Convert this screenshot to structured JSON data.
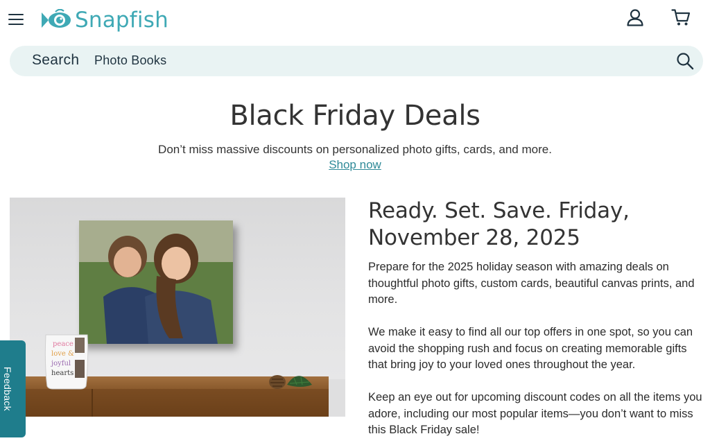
{
  "header": {
    "logo_text": "Snapfish",
    "menu_icon": "hamburger-menu-icon",
    "account_icon": "user-icon",
    "cart_icon": "cart-icon",
    "brand_color": "#3fa9b5"
  },
  "search": {
    "label": "Search",
    "value": "Photo Books",
    "icon": "search-icon",
    "background": "#e9f3f3"
  },
  "hero": {
    "title": "Black Friday Deals",
    "subtitle": "Don’t miss massive discounts on personalized photo gifts, cards, and more.",
    "link_label": "Shop now"
  },
  "image": {
    "mug_text": [
      "peace",
      "love &",
      "joyful",
      "hearts"
    ]
  },
  "article": {
    "heading": "Ready. Set. Save. Friday, November 28, 2025",
    "paragraphs": [
      "Prepare for the 2025 holiday season with amazing deals on thoughtful photo gifts, custom cards, beautiful canvas prints, and more.",
      "We make it easy to find all our top offers in one spot, so you can avoid the shopping rush and focus on creating memorable gifts that bring joy to your loved ones throughout the year.",
      "Keep an eye out for upcoming discount codes on all the items you adore, including our most popular items—you don’t want to miss this Black Friday sale!"
    ]
  },
  "feedback": {
    "label": "Feedback",
    "color": "#1f7d8c"
  }
}
